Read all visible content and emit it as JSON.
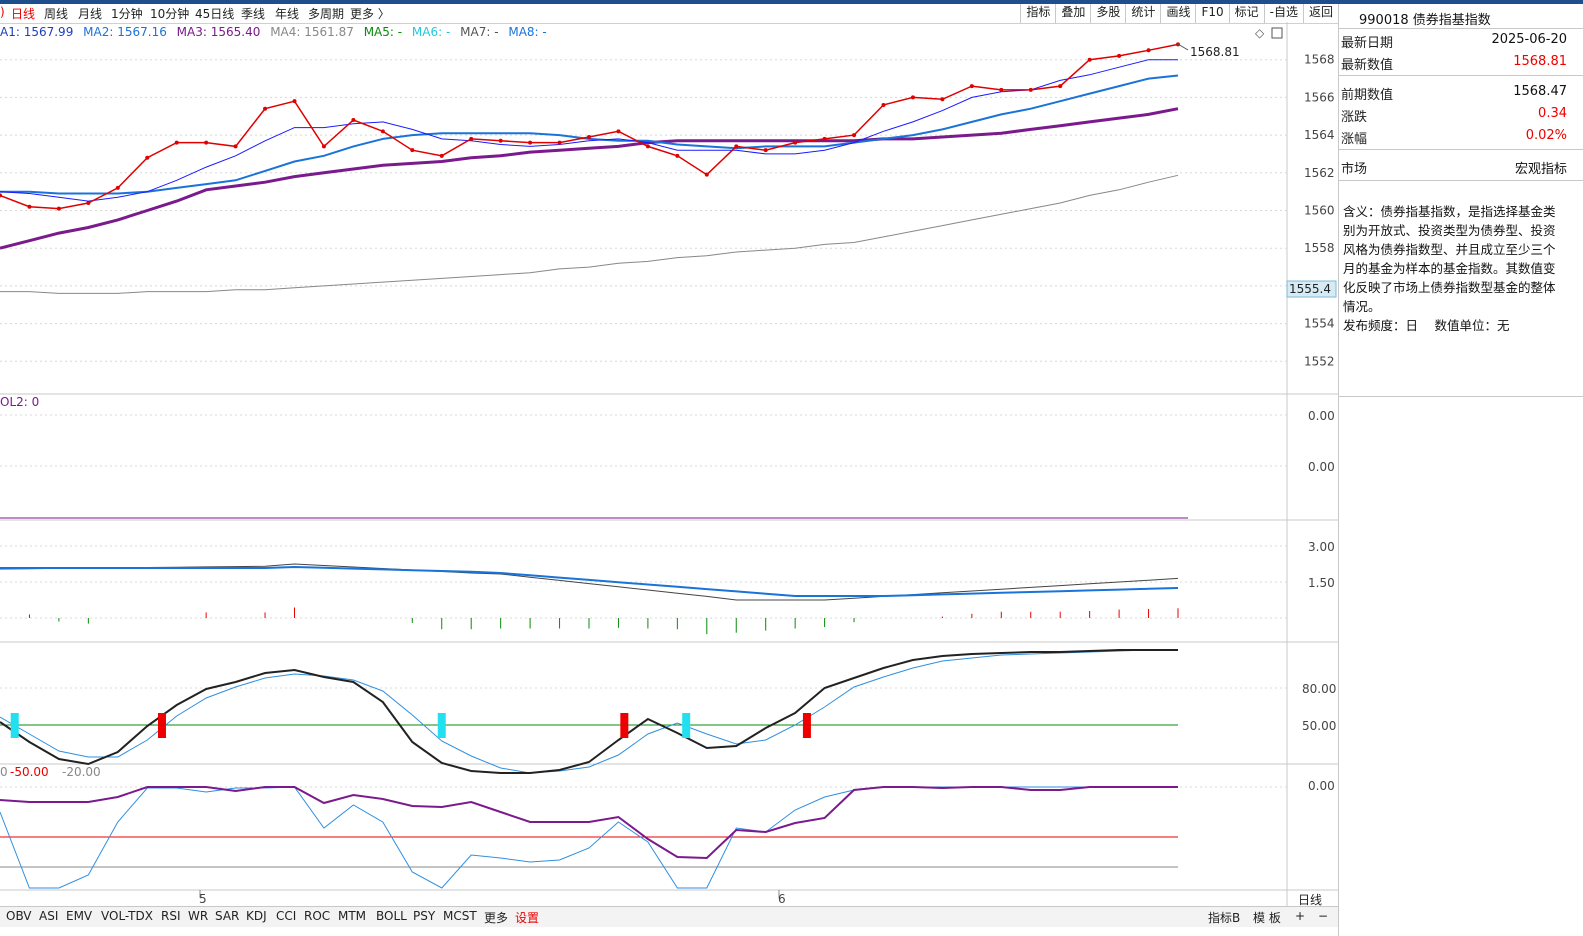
{
  "periods": [
    "日线",
    "周线",
    "月线",
    "1分钟",
    "10分钟",
    "45日线",
    "季线",
    "年线",
    "多周期",
    "更多 〉"
  ],
  "toolbar": [
    "指标",
    "叠加",
    "多股",
    "统计",
    "画线",
    "F10",
    "标记",
    "-自选",
    "返回"
  ],
  "ma_legend": [
    {
      "label": "A1: 1567.99",
      "color": "#1f3fbf"
    },
    {
      "label": "MA2: 1567.16",
      "color": "#1a73d9"
    },
    {
      "label": "MA3: 1565.40",
      "color": "#7a1a8c"
    },
    {
      "label": "MA4: 1561.87",
      "color": "#888888"
    },
    {
      "label": "MA5: -",
      "color": "#0a8a0a"
    },
    {
      "label": "MA6: -",
      "color": "#22c8e0"
    },
    {
      "label": "MA7: -",
      "color": "#555555"
    },
    {
      "label": "MA8: -",
      "color": "#1a73d9"
    }
  ],
  "main_price_ticks": [
    "1568",
    "1566",
    "1564",
    "1562",
    "1560",
    "1558",
    "1556",
    "1554",
    "1552"
  ],
  "last_price_label": "1568.81",
  "cursor_price_label": "1555.4",
  "vol_legend": "OL2: 0",
  "vol_ticks": [
    "0.00",
    "0.00"
  ],
  "macd_ticks": [
    "3.00",
    "1.50"
  ],
  "kdj_ticks": [
    "80.00",
    "50.00"
  ],
  "wr_legend": {
    "a": "0",
    "b": "-50.00",
    "c": "-20.00"
  },
  "wr_ticks": [
    "0.00"
  ],
  "date_labels": [
    "5",
    "6"
  ],
  "indicator_tabs": [
    "OBV",
    "ASI",
    "EMV",
    "VOL-TDX",
    "RSI",
    "WR",
    "SAR",
    "KDJ",
    "CCI",
    "ROC",
    "MTM",
    "BOLL",
    "PSY",
    "MCST",
    "更多",
    "设置"
  ],
  "bottom_right": [
    "指标B",
    "模 板",
    "+",
    "−"
  ],
  "period_indicator": "日线",
  "info": {
    "title": "990018 债券指基指数",
    "rows": [
      {
        "k": "最新日期",
        "v": "2025-06-20",
        "color": "#111111"
      },
      {
        "k": "最新数值",
        "v": "1568.81",
        "color": "#e00000"
      },
      {
        "k": "前期数值",
        "v": "1568.47",
        "color": "#111111"
      },
      {
        "k": "涨跌",
        "v": "0.34",
        "color": "#e00000"
      },
      {
        "k": "涨幅",
        "v": "0.02%",
        "color": "#e00000"
      },
      {
        "k": "市场",
        "v": "宏观指标",
        "color": "#111111"
      }
    ],
    "desc": "含义：债券指基指数，是指选择基金类别为开放式、投资类型为债券型、投资风格为债券指数型、并且成立至少三个月的基金为样本的基金指数。其数值变化反映了市场上债券指数型基金的整体情况。",
    "freq": "发布频度：日　 数值单位：无"
  },
  "chart_data": {
    "type": "line",
    "ylim": [
      1551,
      1569
    ],
    "series": [
      {
        "name": "A1",
        "color": "#e00000",
        "values": [
          1560.8,
          1560.2,
          1560.1,
          1560.4,
          1561.2,
          1562.8,
          1563.6,
          1563.6,
          1563.4,
          1565.4,
          1565.8,
          1563.4,
          1564.8,
          1564.2,
          1563.2,
          1562.9,
          1563.8,
          1563.7,
          1563.6,
          1563.6,
          1563.9,
          1564.2,
          1563.4,
          1562.9,
          1561.9,
          1563.4,
          1563.2,
          1563.6,
          1563.8,
          1564.0,
          1565.6,
          1566.0,
          1565.9,
          1566.6,
          1566.4,
          1566.4,
          1566.6,
          1568.0,
          1568.2,
          1568.5,
          1568.81
        ]
      },
      {
        "name": "MA2",
        "color": "#1a1aff",
        "values": [
          1561.0,
          1560.9,
          1560.7,
          1560.5,
          1560.7,
          1561.0,
          1561.6,
          1562.3,
          1562.9,
          1563.7,
          1564.4,
          1564.4,
          1564.6,
          1564.7,
          1564.3,
          1563.8,
          1563.7,
          1563.5,
          1563.4,
          1563.5,
          1563.7,
          1563.8,
          1563.6,
          1563.2,
          1563.2,
          1563.2,
          1563.0,
          1563.0,
          1563.2,
          1563.6,
          1564.2,
          1564.7,
          1565.3,
          1566.0,
          1566.3,
          1566.4,
          1566.9,
          1567.2,
          1567.6,
          1568.0,
          1568.0
        ]
      },
      {
        "name": "MA3",
        "color": "#1a73d9",
        "values": [
          1561.0,
          1561.0,
          1560.9,
          1560.9,
          1560.9,
          1561.0,
          1561.2,
          1561.4,
          1561.6,
          1562.1,
          1562.6,
          1562.9,
          1563.4,
          1563.8,
          1564.0,
          1564.1,
          1564.1,
          1564.1,
          1564.1,
          1564.0,
          1563.8,
          1563.7,
          1563.7,
          1563.5,
          1563.4,
          1563.3,
          1563.4,
          1563.4,
          1563.4,
          1563.6,
          1563.8,
          1564.0,
          1564.3,
          1564.7,
          1565.1,
          1565.4,
          1565.8,
          1566.2,
          1566.6,
          1567.0,
          1567.16
        ]
      },
      {
        "name": "MA4",
        "color": "#7a1a8c",
        "values": [
          1558.0,
          1558.4,
          1558.8,
          1559.1,
          1559.5,
          1560.0,
          1560.5,
          1561.1,
          1561.3,
          1561.5,
          1561.8,
          1562.0,
          1562.2,
          1562.4,
          1562.5,
          1562.6,
          1562.8,
          1562.9,
          1563.1,
          1563.2,
          1563.3,
          1563.4,
          1563.6,
          1563.7,
          1563.7,
          1563.7,
          1563.7,
          1563.7,
          1563.7,
          1563.7,
          1563.8,
          1563.8,
          1563.9,
          1564.0,
          1564.1,
          1564.3,
          1564.5,
          1564.7,
          1564.9,
          1565.1,
          1565.4
        ]
      },
      {
        "name": "MA5",
        "color": "#888888",
        "values": [
          1555.7,
          1555.7,
          1555.6,
          1555.6,
          1555.6,
          1555.7,
          1555.7,
          1555.7,
          1555.8,
          1555.8,
          1555.9,
          1556.0,
          1556.1,
          1556.2,
          1556.3,
          1556.4,
          1556.5,
          1556.6,
          1556.7,
          1556.9,
          1557.0,
          1557.2,
          1557.3,
          1557.5,
          1557.6,
          1557.8,
          1557.9,
          1558.0,
          1558.2,
          1558.3,
          1558.6,
          1558.9,
          1559.2,
          1559.5,
          1559.8,
          1560.1,
          1560.4,
          1560.8,
          1561.1,
          1561.5,
          1561.87
        ]
      }
    ]
  }
}
